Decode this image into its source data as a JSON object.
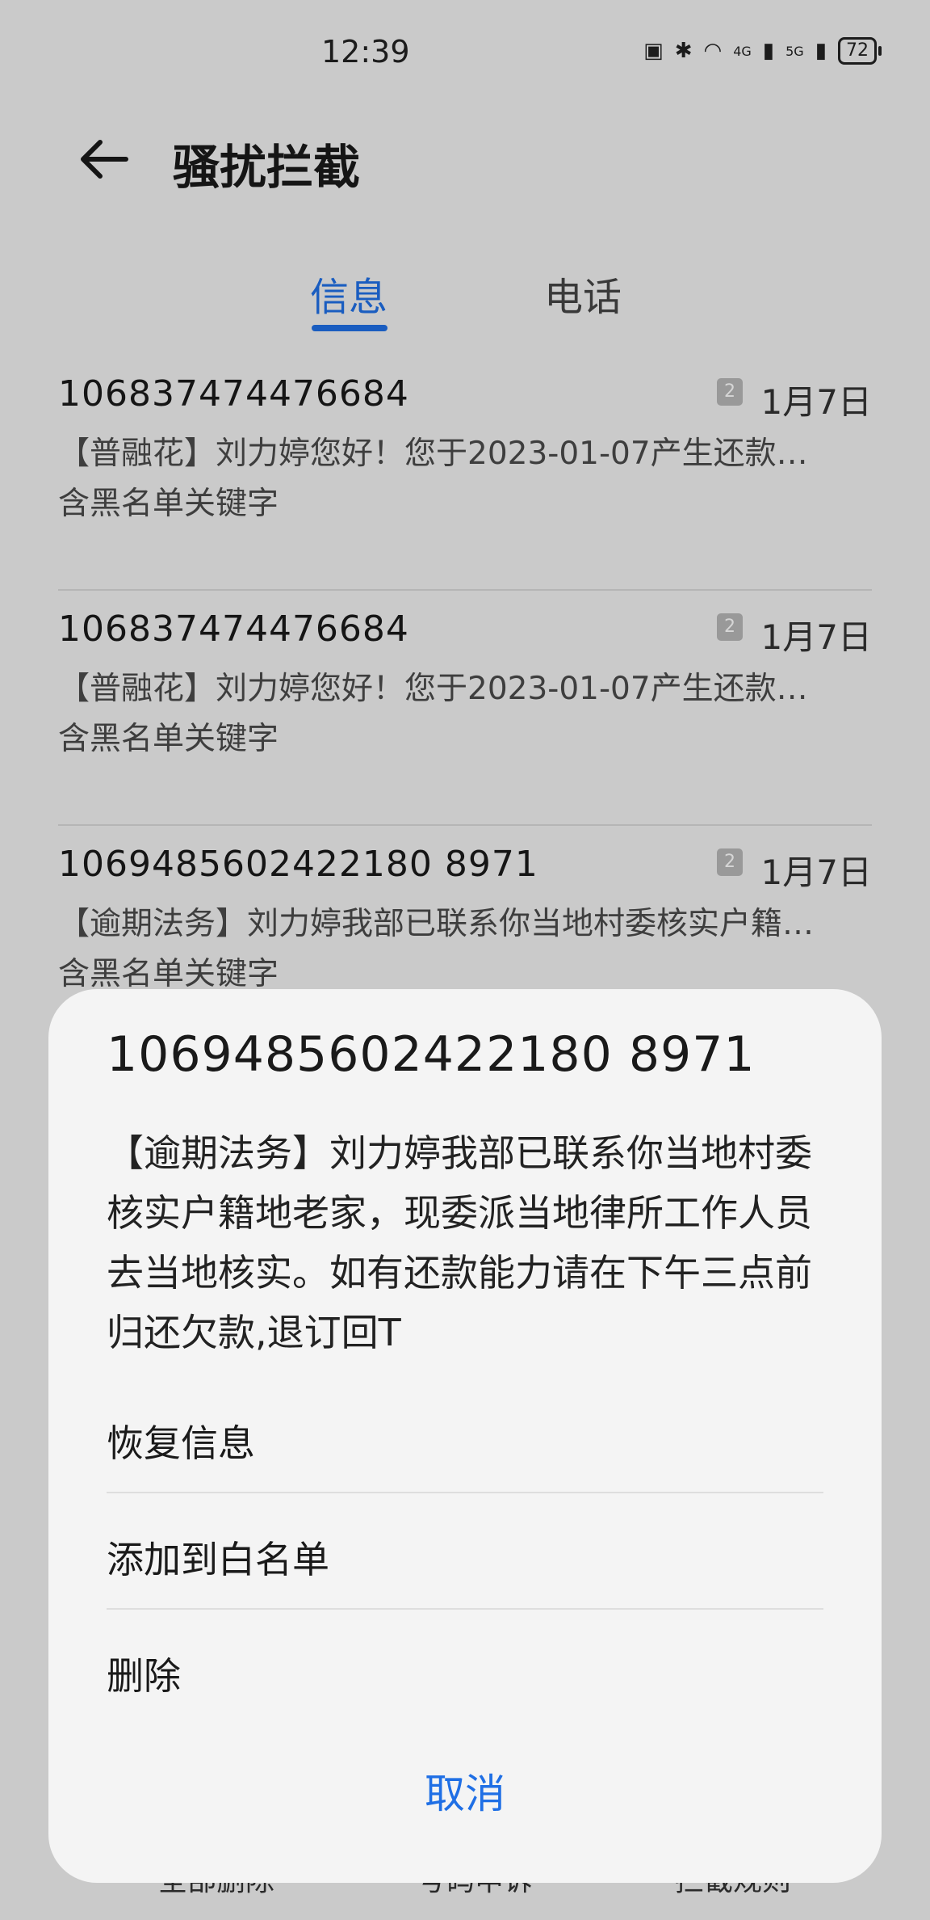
{
  "status_bar": {
    "time": "12:39",
    "battery": "72",
    "network_1": "4G",
    "network_2": "5G"
  },
  "header": {
    "title": "骚扰拦截"
  },
  "tabs": [
    {
      "label": "信息"
    },
    {
      "label": "电话"
    }
  ],
  "messages": [
    {
      "sender": "106837474476684",
      "sim": "2",
      "date": "1月7日",
      "preview": "【普融花】刘力婷您好！您于2023-01-07产生还款…",
      "reason": "含黑名单关键字"
    },
    {
      "sender": "106837474476684",
      "sim": "2",
      "date": "1月7日",
      "preview": "【普融花】刘力婷您好！您于2023-01-07产生还款…",
      "reason": "含黑名单关键字"
    },
    {
      "sender": "1069485602422180 8971",
      "sim": "2",
      "date": "1月7日",
      "preview": "【逾期法务】刘力婷我部已联系你当地村委核实户籍…",
      "reason": "含黑名单关键字"
    }
  ],
  "bottom_nav": [
    {
      "label": "全部删除"
    },
    {
      "label": "号码申诉"
    },
    {
      "label": "拦截规则"
    }
  ],
  "dialog": {
    "sender": "1069485602422180 8971",
    "body": "【逾期法务】刘力婷我部已联系你当地村委核实户籍地老家，现委派当地律所工作人员去当地核实。如有还款能力请在下午三点前归还欠款,退订回T",
    "actions": [
      {
        "label": "恢复信息"
      },
      {
        "label": "添加到白名单"
      },
      {
        "label": "删除"
      }
    ],
    "cancel": "取消"
  },
  "colors": {
    "accent": "#1f6fe5"
  }
}
